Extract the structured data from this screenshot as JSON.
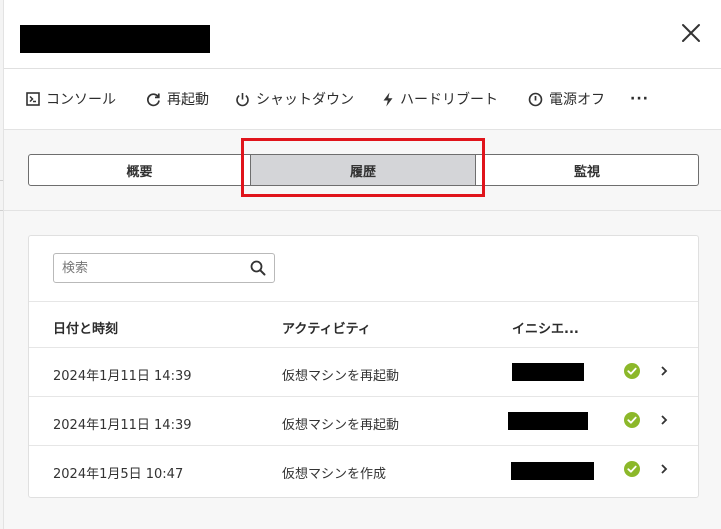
{
  "toolbar": {
    "items": [
      {
        "label": "コンソール",
        "icon": "console-icon"
      },
      {
        "label": "再起動",
        "icon": "restart-icon"
      },
      {
        "label": "シャットダウン",
        "icon": "power-icon"
      },
      {
        "label": "ハードリブート",
        "icon": "lightning-icon"
      },
      {
        "label": "電源オフ",
        "icon": "power-off-icon"
      }
    ],
    "more": "···"
  },
  "tabs": [
    {
      "label": "概要"
    },
    {
      "label": "履歴",
      "selected": true
    },
    {
      "label": "監視"
    }
  ],
  "search": {
    "placeholder": "検索",
    "value": ""
  },
  "table": {
    "headers": [
      "日付と時刻",
      "アクティビティ",
      "イニシエ..."
    ],
    "rows": [
      {
        "datetime": "2024年1月11日 14:39",
        "activity": "仮想マシンを再起動",
        "status": "success"
      },
      {
        "datetime": "2024年1月11日 14:39",
        "activity": "仮想マシンを再起動",
        "status": "success"
      },
      {
        "datetime": "2024年1月5日 10:47",
        "activity": "仮想マシンを作成",
        "status": "success"
      }
    ]
  },
  "colors": {
    "accent_highlight": "#e0141b",
    "success": "#8cb82a",
    "selected_tab": "#d4d5d8"
  }
}
